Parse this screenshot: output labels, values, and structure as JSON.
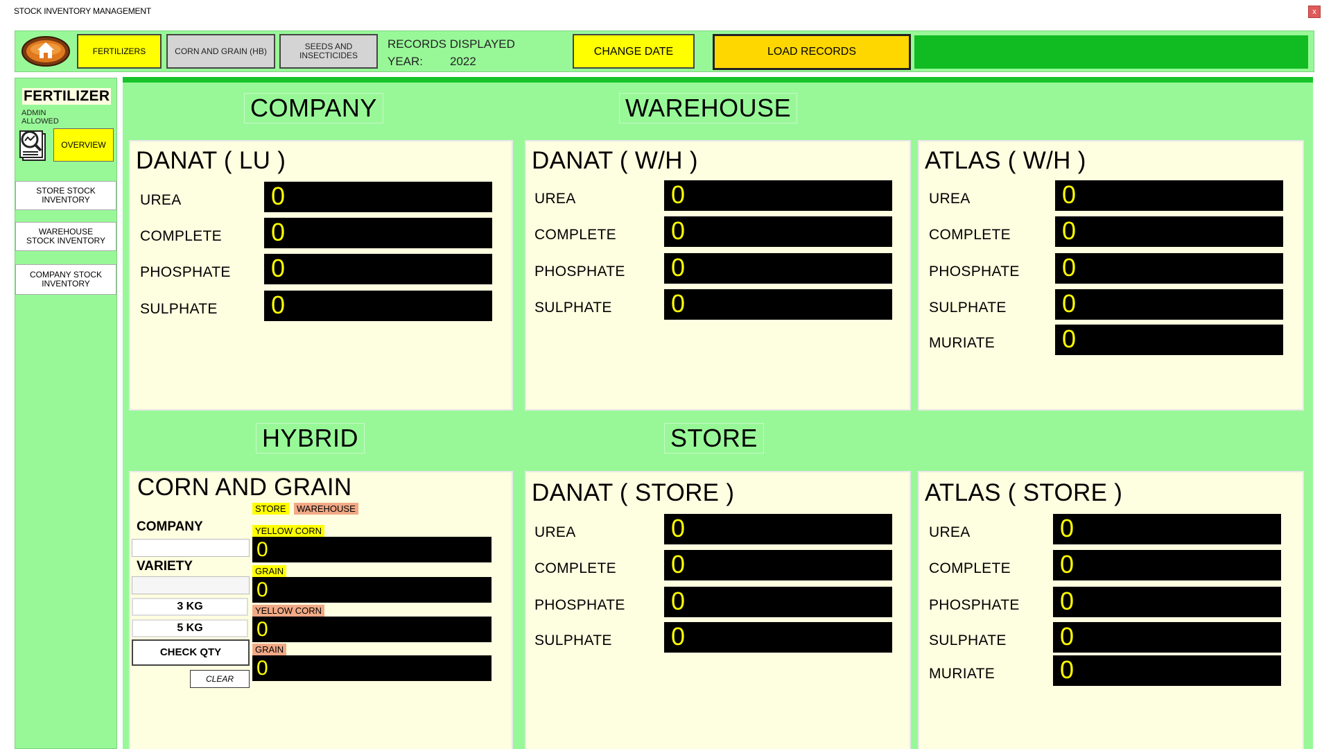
{
  "window": {
    "title": "STOCK INVENTORY MANAGEMENT",
    "close_label": "x"
  },
  "toolbar": {
    "fertilizers_label": "FERTILIZERS",
    "corn_grain_label": "CORN AND GRAIN (HB)",
    "seeds_label": "SEEDS AND INSECTICIDES",
    "records_displayed_label": "RECORDS DISPLAYED",
    "year_label": "YEAR:",
    "year_value": "2022",
    "change_date_label": "CHANGE DATE",
    "load_records_label": "LOAD RECORDS",
    "accent": "#11bb22"
  },
  "sidebar": {
    "title": "FERTILIZER",
    "admin_line1": "ADMIN",
    "admin_line2": "ALLOWED",
    "overview_label": "OVERVIEW",
    "store_stock_label": "STORE STOCK INVENTORY",
    "warehouse_stock_label": "WAREHOUSE STOCK INVENTORY",
    "company_stock_label": "COMPANY STOCK INVENTORY"
  },
  "sections": {
    "company": "COMPANY",
    "warehouse": "WAREHOUSE",
    "hybrid": "HYBRID",
    "store": "STORE"
  },
  "panels": {
    "danat_lu": {
      "title": "DANAT ( LU )",
      "items": [
        {
          "label": "UREA",
          "value": "0"
        },
        {
          "label": "COMPLETE",
          "value": "0"
        },
        {
          "label": "PHOSPHATE",
          "value": "0"
        },
        {
          "label": "SULPHATE",
          "value": "0"
        }
      ]
    },
    "danat_wh": {
      "title": "DANAT ( W/H )",
      "items": [
        {
          "label": "UREA",
          "value": "0"
        },
        {
          "label": "COMPLETE",
          "value": "0"
        },
        {
          "label": "PHOSPHATE",
          "value": "0"
        },
        {
          "label": "SULPHATE",
          "value": "0"
        }
      ]
    },
    "atlas_wh": {
      "title": "ATLAS ( W/H )",
      "items": [
        {
          "label": "UREA",
          "value": "0"
        },
        {
          "label": "COMPLETE",
          "value": "0"
        },
        {
          "label": "PHOSPHATE",
          "value": "0"
        },
        {
          "label": "SULPHATE",
          "value": "0"
        },
        {
          "label": "MURIATE",
          "value": "0"
        }
      ]
    },
    "corn_grain": {
      "title": "CORN AND GRAIN",
      "store_tag": "STORE",
      "warehouse_tag": "WAREHOUSE",
      "company_label": "COMPANY",
      "variety_label": "VARIETY",
      "kg3_label": "3 KG",
      "kg5_label": "5 KG",
      "check_label": "CHECK QTY",
      "clear_label": "CLEAR",
      "items": [
        {
          "label": "YELLOW CORN",
          "value": "0"
        },
        {
          "label": "GRAIN",
          "value": "0"
        },
        {
          "label": "YELLOW CORN",
          "value": "0"
        },
        {
          "label": "GRAIN",
          "value": "0"
        }
      ]
    },
    "danat_store": {
      "title": "DANAT ( STORE )",
      "items": [
        {
          "label": "UREA",
          "value": "0"
        },
        {
          "label": "COMPLETE",
          "value": "0"
        },
        {
          "label": "PHOSPHATE",
          "value": "0"
        },
        {
          "label": "SULPHATE",
          "value": "0"
        }
      ]
    },
    "atlas_store": {
      "title": "ATLAS ( STORE )",
      "items": [
        {
          "label": "UREA",
          "value": "0"
        },
        {
          "label": "COMPLETE",
          "value": "0"
        },
        {
          "label": "PHOSPHATE",
          "value": "0"
        },
        {
          "label": "SULPHATE",
          "value": "0"
        },
        {
          "label": "MURIATE",
          "value": "0"
        }
      ]
    }
  }
}
